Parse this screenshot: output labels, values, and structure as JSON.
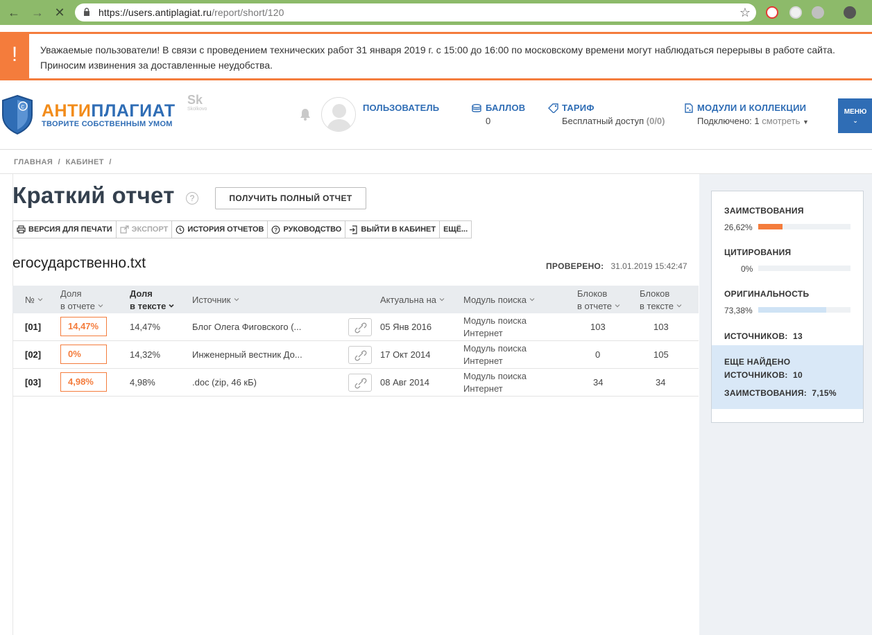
{
  "browser": {
    "url_host": "https://users.antiplagiat.ru",
    "url_path": "/report/short/120"
  },
  "notice": {
    "icon": "!",
    "text": "Уважаемые пользователи! В связи с проведением технических работ 31 января 2019 г. с 15:00 до 16:00 по московскому времени могут наблюдаться перерывы в работе сайта. Приносим извинения за доставленные неудобства."
  },
  "header": {
    "logo_part1": "АНТИ",
    "logo_part2": "ПЛАГИАТ",
    "logo_tagline": "ТВОРИТЕ СОБСТВЕННЫМ УМОМ",
    "skolkovo_mark": "Sk",
    "skolkovo_text": "Skolkovo",
    "user_label": "ПОЛЬЗОВАТЕЛЬ",
    "points_label": "БАЛЛОВ",
    "points_value": "0",
    "tariff_label": "ТАРИФ",
    "tariff_value": "Бесплатный доступ",
    "tariff_count": "(0/0)",
    "modules_label": "МОДУЛИ И КОЛЛЕКЦИИ",
    "modules_connected": "Подключено: 1",
    "modules_view": "смотреть",
    "menu_label": "МЕНЮ"
  },
  "breadcrumb": {
    "home": "ГЛАВНАЯ",
    "cabinet": "КАБИНЕТ",
    "separator": "/"
  },
  "page": {
    "title": "Краткий отчет",
    "help": "?",
    "full_report_button": "ПОЛУЧИТЬ ПОЛНЫЙ ОТЧЕТ",
    "filename": "егосударственно.txt",
    "checked_label": "ПРОВЕРЕНО:",
    "checked_value": "31.01.2019 15:42:47"
  },
  "toolbar": {
    "print": "ВЕРСИЯ ДЛЯ ПЕЧАТИ",
    "export": "ЭКСПОРТ",
    "history": "ИСТОРИЯ ОТЧЕТОВ",
    "guide": "РУКОВОДСТВО",
    "exit": "ВЫЙТИ В КАБИНЕТ",
    "more": "ЕЩЁ..."
  },
  "table": {
    "headers": {
      "num": "№",
      "share_report_1": "Доля",
      "share_report_2": "в отчете",
      "share_text_1": "Доля",
      "share_text_2": "в тексте",
      "source": "Источник",
      "actual": "Актуальна на",
      "module": "Модуль поиска",
      "blocks_report_1": "Блоков",
      "blocks_report_2": "в отчете",
      "blocks_text_1": "Блоков",
      "blocks_text_2": "в тексте"
    },
    "rows": [
      {
        "num": "[01]",
        "share_report": "14,47%",
        "share_text": "14,47%",
        "source": "Блог Олега Фиговского (...",
        "date": "05 Янв 2016",
        "module_1": "Модуль поиска",
        "module_2": "Интернет",
        "blocks_report": "103",
        "blocks_text": "103"
      },
      {
        "num": "[02]",
        "share_report": "0%",
        "share_text": "14,32%",
        "source": "Инженерный вестник До...",
        "date": "17 Окт 2014",
        "module_1": "Модуль поиска",
        "module_2": "Интернет",
        "blocks_report": "0",
        "blocks_text": "105"
      },
      {
        "num": "[03]",
        "share_report": "4,98%",
        "share_text": "4,98%",
        "source": ".doc (zip, 46 кБ)",
        "date": "08 Авг 2014",
        "module_1": "Модуль поиска",
        "module_2": "Интернет",
        "blocks_report": "34",
        "blocks_text": "34"
      }
    ]
  },
  "stats": {
    "borrow_label": "ЗАИМСТВОВАНИЯ",
    "borrow_value": "26,62%",
    "borrow_fraction": 0.2662,
    "cite_label": "ЦИТИРОВАНИЯ",
    "cite_value": "0%",
    "cite_fraction": 0,
    "orig_label": "ОРИГИНАЛЬНОСТЬ",
    "orig_value": "73,38%",
    "orig_fraction": 0.7338,
    "sources_label": "ИСТОЧНИКОВ:",
    "sources_value": "13",
    "more_found_1": "ЕЩЕ НАЙДЕНО",
    "more_found_2": "ИСТОЧНИКОВ:",
    "more_found_value": "10",
    "more_borrow_label": "ЗАИМСТВОВАНИЯ:",
    "more_borrow_value": "7,15%",
    "colors": {
      "borrow": "#f47c3c",
      "orig": "#cfe3f5",
      "accent": "#2f6db5"
    }
  }
}
